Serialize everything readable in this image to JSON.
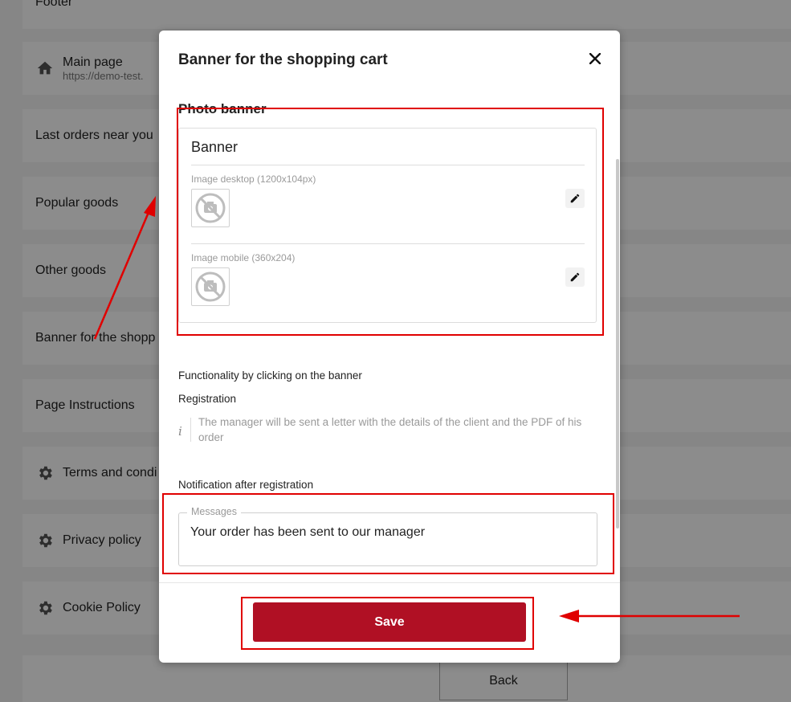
{
  "background_page": {
    "items": [
      {
        "label": "Footer",
        "icon": null
      },
      {
        "label": "Main page",
        "sublabel": "https://demo-test.",
        "icon": "home-icon"
      },
      {
        "label": "Last orders near you",
        "icon": null
      },
      {
        "label": "Popular goods",
        "icon": null
      },
      {
        "label": "Other goods",
        "icon": null
      },
      {
        "label": "Banner for the shopp",
        "icon": null
      },
      {
        "label": "Page Instructions",
        "icon": null
      },
      {
        "label": "Terms and condi",
        "icon": "gear-icon"
      },
      {
        "label": "Privacy policy",
        "icon": "gear-icon"
      },
      {
        "label": "Cookie Policy",
        "icon": "gear-icon"
      }
    ],
    "back_label": "Back"
  },
  "modal": {
    "title": "Banner for the shopping cart",
    "close_icon": "close-icon",
    "photo_banner": {
      "section_title": "Photo banner",
      "name": "Banner",
      "desktop_label": "Image desktop (1200x104px)",
      "mobile_label": "Image mobile (360x204)",
      "placeholder_icon": "no-image-icon",
      "edit_icon": "pencil-icon"
    },
    "functionality_label": "Functionality by clicking on the banner",
    "functionality_value": "Registration",
    "info_text": "The manager will be sent a letter with the details of the client and the PDF of his order",
    "info_icon_glyph": "i",
    "notification_label": "Notification after registration",
    "messages_legend": "Messages",
    "messages_value": "Your order has been sent to our manager",
    "save_label": "Save"
  },
  "colors": {
    "primary_button": "#b01024",
    "annotation_red": "#e00000",
    "overlay": "rgba(0,0,0,0.45)"
  }
}
